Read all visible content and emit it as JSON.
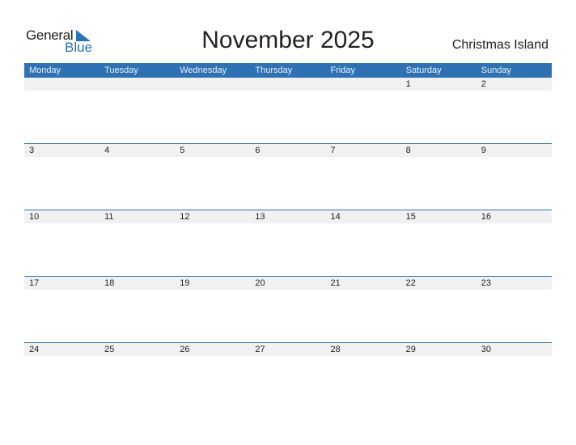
{
  "logo": {
    "word1": "General",
    "word2": "Blue"
  },
  "title": "November 2025",
  "region": "Christmas Island",
  "weekdays": [
    "Monday",
    "Tuesday",
    "Wednesday",
    "Thursday",
    "Friday",
    "Saturday",
    "Sunday"
  ],
  "weeks": [
    [
      "",
      "",
      "",
      "",
      "",
      "1",
      "2"
    ],
    [
      "3",
      "4",
      "5",
      "6",
      "7",
      "8",
      "9"
    ],
    [
      "10",
      "11",
      "12",
      "13",
      "14",
      "15",
      "16"
    ],
    [
      "17",
      "18",
      "19",
      "20",
      "21",
      "22",
      "23"
    ],
    [
      "24",
      "25",
      "26",
      "27",
      "28",
      "29",
      "30"
    ]
  ],
  "colors": {
    "accent": "#2e72b4",
    "strip": "#f1f1f1"
  }
}
